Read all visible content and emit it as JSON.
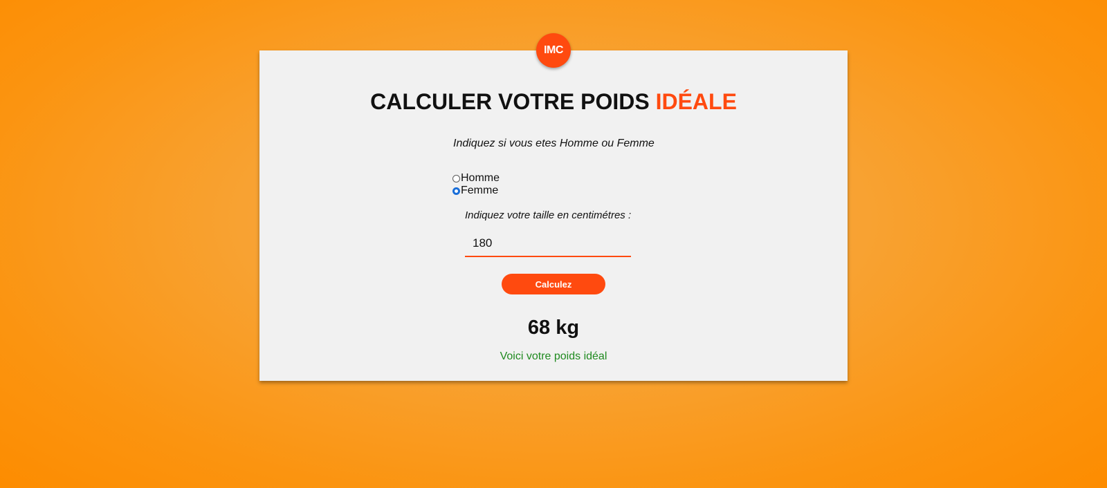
{
  "logo": {
    "text": "IMC"
  },
  "title": {
    "main": "CALCULER VOTRE POIDS ",
    "accent": "IDÉALE"
  },
  "gender": {
    "prompt": "Indiquez si vous etes Homme ou Femme",
    "options": [
      {
        "label": "Homme",
        "checked": false
      },
      {
        "label": "Femme",
        "checked": true
      }
    ]
  },
  "height": {
    "prompt": "Indiquez votre taille en centimétres :",
    "value": "180"
  },
  "button": {
    "label": "Calculez"
  },
  "result": {
    "value": "68 kg",
    "message": "Voici votre poids idéal"
  },
  "colors": {
    "accent": "#ff4a0f",
    "success": "#1f8a1f",
    "background": "#f8a232",
    "card": "#f1f1f1"
  }
}
